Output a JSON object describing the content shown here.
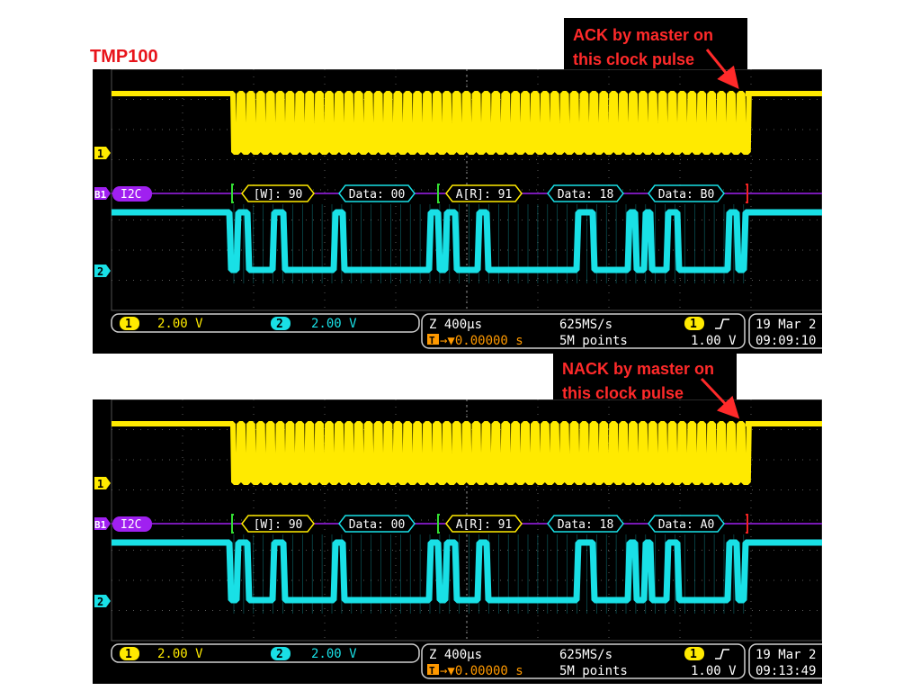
{
  "title": "TMP100",
  "scopes": [
    {
      "callout": [
        "ACK by master on",
        "this clock pulse"
      ],
      "ch1_marker": "1",
      "ch2_marker": "2",
      "bus_marker": "B1",
      "bus_name": "I2C",
      "packets": [
        "[W]: 90",
        "Data: 00",
        "A[R]: 91",
        "Data: 18",
        "Data: B0"
      ],
      "status": {
        "ch1_badge": "1",
        "ch1_scale": "2.00 V",
        "ch2_badge": "2",
        "ch2_scale": "2.00 V",
        "zoom": "Z 400µs",
        "trigger_icon": "T",
        "trigger_pos": "→▼0.00000 s",
        "sample_rate": "625MS/s",
        "record_length": "5M points",
        "trigger_source": "1",
        "trigger_slope": "rising-edge-icon",
        "trigger_level": "1.00 V",
        "date": "19 Mar 2",
        "time": "09:09:10"
      }
    },
    {
      "callout": [
        "NACK by master on",
        "this clock pulse"
      ],
      "ch1_marker": "1",
      "ch2_marker": "2",
      "bus_marker": "B1",
      "bus_name": "I2C",
      "packets": [
        "[W]: 90",
        "Data: 00",
        "A[R]: 91",
        "Data: 18",
        "Data: A0"
      ],
      "status": {
        "ch1_badge": "1",
        "ch1_scale": "2.00 V",
        "ch2_badge": "2",
        "ch2_scale": "2.00 V",
        "zoom": "Z 400µs",
        "trigger_icon": "T",
        "trigger_pos": "→▼0.00000 s",
        "sample_rate": "625MS/s",
        "record_length": "5M points",
        "trigger_source": "1",
        "trigger_slope": "rising-edge-icon",
        "trigger_level": "1.00 V",
        "date": "19 Mar 2",
        "time": "09:13:49"
      }
    }
  ],
  "colors": {
    "ch1": "#ffea00",
    "ch2": "#19e0e6",
    "bus": "#a020f0",
    "callout_text": "#ff2a2a",
    "title": "#e8141b"
  }
}
